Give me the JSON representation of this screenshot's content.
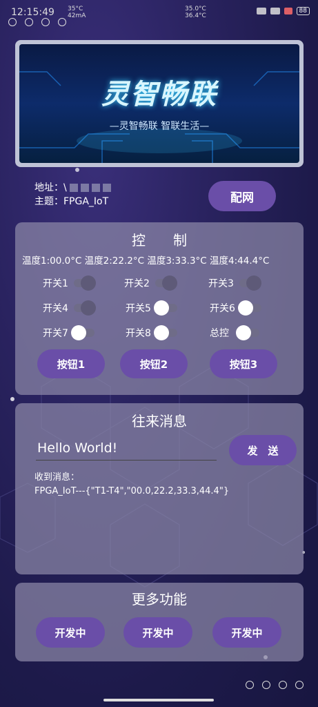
{
  "status": {
    "time": "12:15:49",
    "temp_left": "35°C",
    "sub_left": "42mA",
    "temp_right_1": "35.0°C",
    "temp_right_2": "36.4°C",
    "battery": "88"
  },
  "banner": {
    "title": "灵智畅联",
    "subtitle": "—灵智畅联 智联生活—"
  },
  "info": {
    "addr_label": "地址：",
    "addr_value": "\\",
    "topic_label": "主题：",
    "topic_value": "FPGA_IoT"
  },
  "config_button": "配网",
  "control": {
    "title": "控　　制",
    "temps": [
      "温度1:00.0°C",
      "温度2:22.2°C",
      "温度3:33.3°C",
      "温度4:44.4°C"
    ],
    "switches": [
      {
        "label": "开关1",
        "on": false
      },
      {
        "label": "开关2",
        "on": false
      },
      {
        "label": "开关3",
        "on": false
      },
      {
        "label": "开关4",
        "on": false
      },
      {
        "label": "开关5",
        "on": true
      },
      {
        "label": "开关6",
        "on": true
      },
      {
        "label": "开关7",
        "on": true
      },
      {
        "label": "开关8",
        "on": true
      },
      {
        "label": "总控",
        "on": true
      }
    ],
    "buttons": [
      "按钮1",
      "按钮2",
      "按钮3"
    ]
  },
  "messages": {
    "title": "往来消息",
    "input_value": "Hello World!",
    "send": "发　送",
    "received_label": "收到消息：",
    "received_text": "FPGA_IoT---{\"T1-T4\",\"00.0,22.2,33.3,44.4\"}"
  },
  "more": {
    "title": "更多功能",
    "buttons": [
      "开发中",
      "开发中",
      "开发中"
    ]
  },
  "colors": {
    "accent": "#6a4ea8",
    "panel": "#8c88a8",
    "bg": "#1d1a4a"
  }
}
